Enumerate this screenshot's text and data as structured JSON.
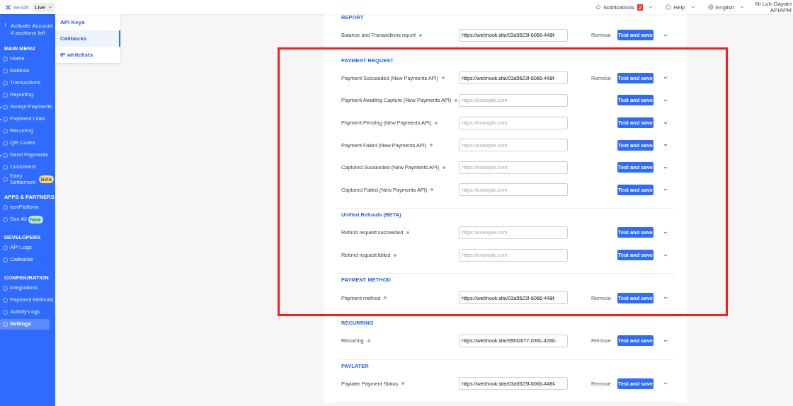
{
  "topbar": {
    "logo": "xendit",
    "environment": "Live",
    "notifications": {
      "label": "Notifications",
      "count": "2"
    },
    "help": "Help",
    "language": "English",
    "user": {
      "name": "Ni Luh Gayatri",
      "account": "APIAPM"
    }
  },
  "sidebar": {
    "activate": {
      "title": "Activate Account",
      "subtitle": "4 sections left"
    },
    "groups": [
      {
        "heading": "MAIN MENU",
        "items": [
          {
            "label": "Home",
            "expandable": false,
            "selected": false
          },
          {
            "label": "Balance",
            "expandable": false,
            "selected": false
          },
          {
            "label": "Transactions",
            "expandable": false,
            "selected": false
          },
          {
            "label": "Reporting",
            "expandable": false,
            "selected": false
          },
          {
            "label": "Accept Payments",
            "expandable": true,
            "selected": false
          },
          {
            "label": "Payment Links",
            "expandable": true,
            "selected": false
          },
          {
            "label": "Recurring",
            "expandable": false,
            "selected": false
          },
          {
            "label": "QR Codes",
            "expandable": false,
            "selected": false
          },
          {
            "label": "Send Payments",
            "expandable": true,
            "selected": false
          },
          {
            "label": "Customers",
            "expandable": false,
            "selected": false
          },
          {
            "label": "Early Settlement",
            "expandable": false,
            "selected": false,
            "badge": {
              "text": "Beta",
              "color": "#fcd772"
            }
          }
        ]
      },
      {
        "heading": "APPS & PARTNERS",
        "items": [
          {
            "label": "xenPlatform",
            "expandable": false,
            "selected": false
          },
          {
            "label": "See All",
            "expandable": false,
            "selected": false,
            "badge": {
              "text": "New",
              "color": "#b6f0d2"
            }
          }
        ]
      },
      {
        "heading": "DEVELOPERS",
        "items": [
          {
            "label": "API Logs",
            "expandable": false,
            "selected": false
          },
          {
            "label": "Callbacks",
            "expandable": false,
            "selected": false
          }
        ]
      },
      {
        "heading": "CONFIGURATION",
        "items": [
          {
            "label": "Integrations",
            "expandable": false,
            "selected": false
          },
          {
            "label": "Payment Methods",
            "expandable": false,
            "selected": false
          },
          {
            "label": "Activity Logs",
            "expandable": false,
            "selected": false
          },
          {
            "label": "Settings",
            "expandable": false,
            "selected": true
          }
        ]
      }
    ]
  },
  "submenu": [
    {
      "label": "API Keys",
      "selected": false
    },
    {
      "label": "Callbacks",
      "selected": true
    },
    {
      "label": "IP whitelists",
      "selected": false
    }
  ],
  "sections": [
    {
      "title": "REPORT",
      "rows": [
        {
          "label": "Balance and Transactions report",
          "value": "https://webhook.site/03a5523f-6066-448f-",
          "remove": "Remove",
          "button": "Test and save"
        }
      ]
    },
    {
      "title": "PAYMENT REQUEST",
      "rows": [
        {
          "label": "Payment Succeeded (New Payments API)",
          "value": "https://webhook.site/03a5523f-6066-448f-",
          "remove": "Remove",
          "button": "Test and save"
        },
        {
          "label": "Payment Awaiting Capture (New Payments API)",
          "placeholder": "https://example.com",
          "button": "Test and save"
        },
        {
          "label": "Payment Pending (New Payments API)",
          "placeholder": "https://example.com",
          "button": "Test and save"
        },
        {
          "label": "Payment Failed (New Payments API)",
          "placeholder": "https://example.com",
          "button": "Test and save"
        },
        {
          "label": "Captured Succeeded (New Payments API)",
          "placeholder": "https://example.com",
          "button": "Test and save"
        },
        {
          "label": "Captured Failed (New Payments API)",
          "placeholder": "https://example.com",
          "button": "Test and save"
        }
      ]
    },
    {
      "title": "Unified Refunds (BETA)",
      "rows": [
        {
          "label": "Refund request succeeded",
          "placeholder": "https://example.com",
          "button": "Test and save"
        },
        {
          "label": "Refund request failed",
          "placeholder": "https://example.com",
          "button": "Test and save"
        }
      ]
    },
    {
      "title": "PAYMENT METHOD",
      "rows": [
        {
          "label": "Payment method",
          "value": "https://webhook.site/03a5523f-6066-448f-",
          "remove": "Remove",
          "button": "Test and save"
        }
      ]
    },
    {
      "title": "RECURRING",
      "rows": [
        {
          "label": "Recurring",
          "value": "https://webhook.site/95bf2677-039c-4280-",
          "remove": "Remove",
          "button": "Test and save"
        }
      ]
    },
    {
      "title": "PAYLATER",
      "rows": [
        {
          "label": "Paylater Payment Status",
          "value": "https://webhook.site/03a5523f-6066-448f-",
          "remove": "Remove",
          "button": "Test and save"
        }
      ]
    }
  ]
}
